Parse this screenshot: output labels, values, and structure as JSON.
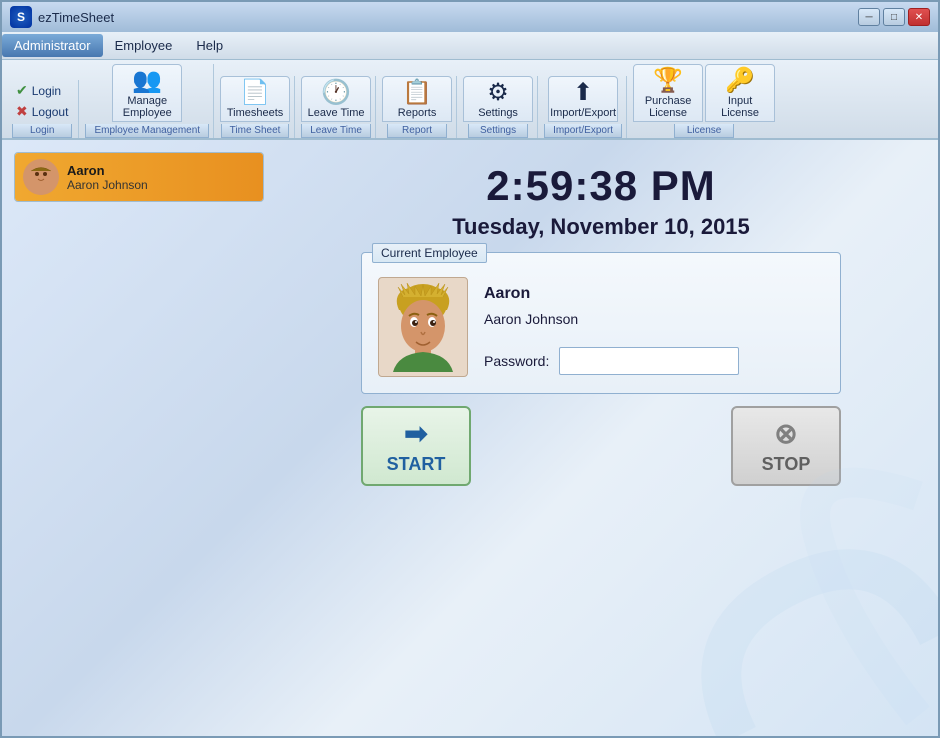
{
  "window": {
    "title": "ezTimeSheet"
  },
  "titlebar": {
    "title": "ezTimeSheet",
    "logo": "S",
    "min_btn": "─",
    "max_btn": "□",
    "close_btn": "✕"
  },
  "menubar": {
    "items": [
      {
        "id": "administrator",
        "label": "Administrator",
        "active": true
      },
      {
        "id": "employee",
        "label": "Employee",
        "active": false
      },
      {
        "id": "help",
        "label": "Help",
        "active": false
      }
    ]
  },
  "toolbar": {
    "groups": [
      {
        "id": "login-group",
        "label": "Login",
        "buttons": [
          {
            "id": "login",
            "label": "Login",
            "icon": "✔"
          },
          {
            "id": "logout",
            "label": "Logout",
            "icon": "✖"
          }
        ]
      },
      {
        "id": "employee-management",
        "label": "Employee Management",
        "buttons": [
          {
            "id": "manage-employee",
            "label": "Manage Employee",
            "icon": "👥"
          }
        ]
      },
      {
        "id": "time-sheet",
        "label": "Time Sheet",
        "buttons": [
          {
            "id": "timesheets",
            "label": "Timesheets",
            "icon": "📄"
          }
        ]
      },
      {
        "id": "leave-time",
        "label": "Leave Time",
        "buttons": [
          {
            "id": "leave-time",
            "label": "Leave Time",
            "icon": "🕐"
          }
        ]
      },
      {
        "id": "report",
        "label": "Report",
        "buttons": [
          {
            "id": "reports",
            "label": "Reports",
            "icon": "📋"
          }
        ]
      },
      {
        "id": "settings",
        "label": "Settings",
        "buttons": [
          {
            "id": "settings",
            "label": "Settings",
            "icon": "⚙"
          }
        ]
      },
      {
        "id": "import-export",
        "label": "Import/Export",
        "buttons": [
          {
            "id": "import-export",
            "label": "Import/Export",
            "icon": "⬆"
          }
        ]
      },
      {
        "id": "license",
        "label": "License",
        "buttons": [
          {
            "id": "purchase-license",
            "label": "Purchase License",
            "icon": "🏆"
          },
          {
            "id": "input-license",
            "label": "Input License",
            "icon": "🔑"
          }
        ]
      }
    ]
  },
  "employees": [
    {
      "id": "aaron",
      "short_name": "Aaron",
      "full_name": "Aaron Johnson",
      "selected": true
    }
  ],
  "clock": {
    "time": "2:59:38 PM",
    "date": "Tuesday, November 10, 2015"
  },
  "current_employee_panel": {
    "title": "Current Employee",
    "short_name": "Aaron",
    "full_name": "Aaron Johnson",
    "password_label": "Password:"
  },
  "buttons": {
    "start_label": "START",
    "stop_label": "STOP"
  }
}
